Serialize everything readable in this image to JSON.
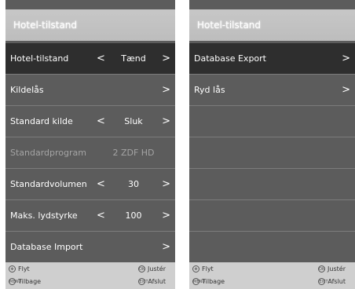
{
  "left_panel": {
    "title": "Hotel-tilstand",
    "rows": [
      {
        "label": "Hotel-tilstand",
        "left_arrow": "<",
        "value": "Tænd",
        "right_arrow": ">"
      },
      {
        "label": "Kildelås",
        "right_arrow": ">"
      },
      {
        "label": "Standard kilde",
        "left_arrow": "<",
        "value": "Sluk",
        "right_arrow": ">"
      },
      {
        "label": "Standardprogram",
        "value": "2 ZDF HD"
      },
      {
        "label": "Standardvolumen",
        "left_arrow": "<",
        "value": "30",
        "right_arrow": ">"
      },
      {
        "label": "Maks. lydstyrke",
        "left_arrow": "<",
        "value": "100",
        "right_arrow": ">"
      },
      {
        "label": "Database Import",
        "right_arrow": ">"
      }
    ],
    "footer": {
      "move": "Flyt",
      "back": "Tilbage",
      "adjust": "Justér",
      "exit": "Afslut"
    }
  },
  "right_panel": {
    "title": "Hotel-tilstand",
    "rows": [
      {
        "label": "Database Export",
        "right_arrow": ">"
      },
      {
        "label": "Ryd lås",
        "right_arrow": ">"
      }
    ],
    "footer": {
      "move": "Flyt",
      "back": "Tilbage",
      "adjust": "Justér",
      "exit": "Afslut"
    }
  },
  "footer_icons": {
    "ok": "OK",
    "menu": "MENU",
    "exit": "EXIT"
  }
}
